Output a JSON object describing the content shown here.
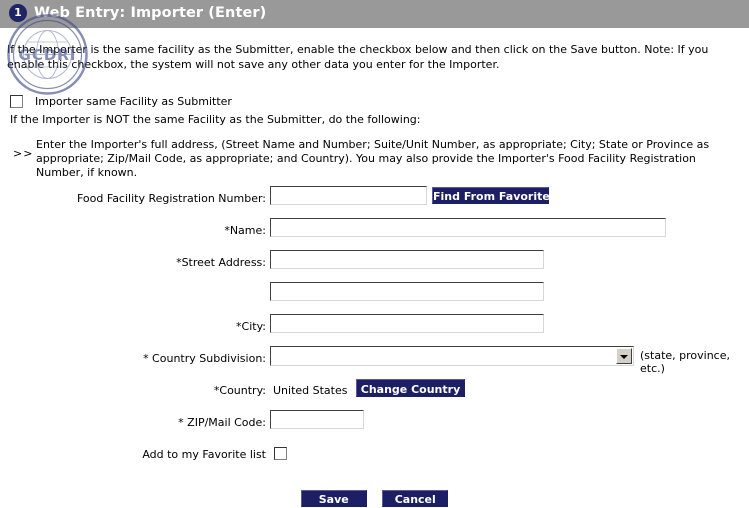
{
  "header": {
    "step_number": "1",
    "title": "Web Entry: Importer (Enter)",
    "bar_color": "#999999",
    "badge_color": "#1f2464"
  },
  "watermark": {
    "text": "GCDRI"
  },
  "intro_text": "If the Importer is the same facility as the Submitter, enable the checkbox below and then click on the Save button. Note: If you enable this checkbox, the system will not save any other data you enter for the Importer.",
  "same_facility": {
    "label": "Importer same Facility as Submitter",
    "checked": false
  },
  "not_same_text": "If the Importer is NOT the same Facility as the Submitter, do the following:",
  "instruction": {
    "marker": ">>",
    "text": "Enter the Importer's full address, (Street Name and Number; Suite/Unit Number, as appropriate; City; State or Province as appropriate; Zip/Mail Code, as appropriate; and Country). You may also provide the Importer's Food Facility Registration Number, if known."
  },
  "form": {
    "registration": {
      "label": "Food Facility Registration Number:",
      "value": "",
      "find_button": "Find From Favorites"
    },
    "name": {
      "label": "*Name:",
      "value": ""
    },
    "street_address": {
      "label": "*Street Address:",
      "value": ""
    },
    "street_address_2": {
      "label": "",
      "value": ""
    },
    "city": {
      "label": "*City:",
      "value": ""
    },
    "country_subdivision": {
      "label": "* Country Subdivision:",
      "selected": "",
      "hint": "(state, province, etc.)"
    },
    "country": {
      "label": "*Country:",
      "value": "United States",
      "change_button": "Change Country"
    },
    "zip": {
      "label": "* ZIP/Mail Code:",
      "value": ""
    },
    "favorite": {
      "label": "Add to my Favorite list",
      "checked": false
    }
  },
  "actions": {
    "save": "Save",
    "cancel": "Cancel",
    "button_color": "#1c1f63"
  }
}
